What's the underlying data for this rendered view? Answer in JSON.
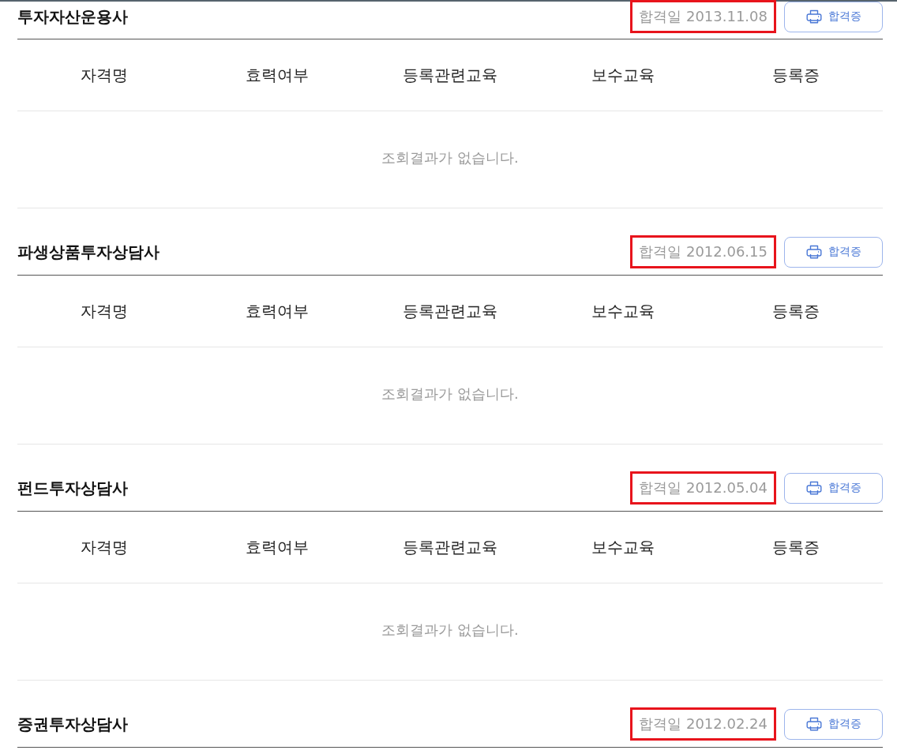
{
  "sections": [
    {
      "title": "투자자산운용사",
      "pass_date": {
        "text": "합격일 2013.11.08",
        "highlighted": true
      },
      "button": {
        "label": "합격증"
      },
      "table": {
        "columns": [
          "자격명",
          "효력여부",
          "등록관련교육",
          "보수교육",
          "등록증"
        ],
        "empty_message": "조회결과가 없습니다."
      }
    },
    {
      "title": "파생상품투자상담사",
      "pass_date": {
        "text": "합격일 2012.06.15",
        "highlighted": true
      },
      "button": {
        "label": "합격증"
      },
      "table": {
        "columns": [
          "자격명",
          "효력여부",
          "등록관련교육",
          "보수교육",
          "등록증"
        ],
        "empty_message": "조회결과가 없습니다."
      }
    },
    {
      "title": "펀드투자상담사",
      "pass_date": {
        "text": "합격일 2012.05.04",
        "highlighted": true
      },
      "button": {
        "label": "합격증"
      },
      "table": {
        "columns": [
          "자격명",
          "효력여부",
          "등록관련교육",
          "보수교육",
          "등록증"
        ],
        "empty_message": "조회결과가 없습니다."
      }
    },
    {
      "title": "증권투자상담사",
      "pass_date": {
        "text": "합격일 2012.02.24",
        "highlighted": true
      },
      "button": {
        "label": "합격증"
      }
    }
  ]
}
